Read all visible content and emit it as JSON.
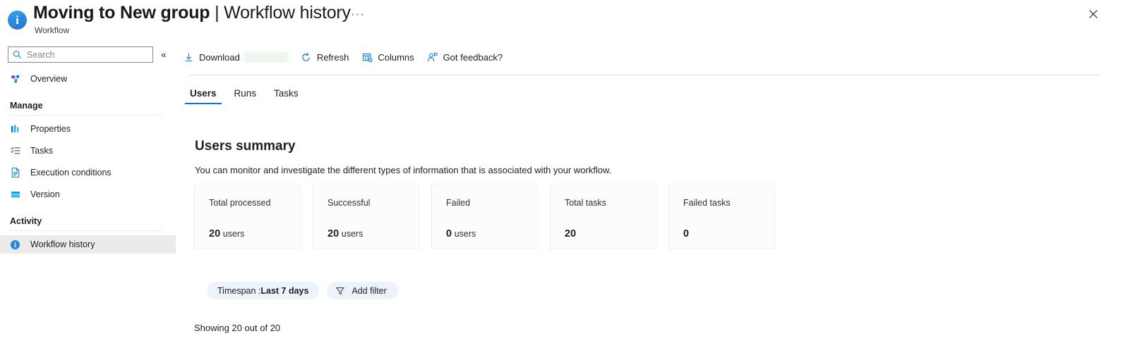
{
  "header": {
    "icon": "info-circle-icon",
    "title_main": "Moving to New group",
    "title_separator": "|",
    "title_secondary": "Workflow history",
    "subtitle": "Workflow",
    "overflow_label": "···",
    "close_label": "Close"
  },
  "sidebar": {
    "search": {
      "value": "",
      "placeholder": "Search",
      "icon": "search-icon"
    },
    "collapse": {
      "label": "«",
      "icon": "chevron-double-left-icon"
    },
    "overview": {
      "label": "Overview",
      "icon": "overview-icon"
    },
    "groups": [
      {
        "label": "Manage",
        "items": [
          {
            "label": "Properties",
            "icon": "properties-icon"
          },
          {
            "label": "Tasks",
            "icon": "tasks-list-icon"
          },
          {
            "label": "Execution conditions",
            "icon": "document-icon"
          },
          {
            "label": "Version",
            "icon": "version-icon"
          }
        ]
      },
      {
        "label": "Activity",
        "items": [
          {
            "label": "Workflow history",
            "icon": "info-circle-icon",
            "selected": true
          }
        ]
      }
    ]
  },
  "toolbar": {
    "items": [
      {
        "label": "Download",
        "icon": "download-icon",
        "redacted_after": true
      },
      {
        "label": "Refresh",
        "icon": "refresh-icon"
      },
      {
        "label": "Columns",
        "icon": "columns-icon"
      },
      {
        "label": "Got feedback?",
        "icon": "feedback-person-icon"
      }
    ]
  },
  "tabs": [
    {
      "label": "Users",
      "active": true
    },
    {
      "label": "Runs",
      "active": false
    },
    {
      "label": "Tasks",
      "active": false
    }
  ],
  "main": {
    "section_title": "Users summary",
    "section_description": "You can monitor and investigate the different types of information that is associated with your workflow.",
    "cards": [
      {
        "label": "Total processed",
        "value": "20",
        "unit": "users"
      },
      {
        "label": "Successful",
        "value": "20",
        "unit": "users"
      },
      {
        "label": "Failed",
        "value": "0",
        "unit": "users"
      },
      {
        "label": "Total tasks",
        "value": "20",
        "unit": ""
      },
      {
        "label": "Failed tasks",
        "value": "0",
        "unit": ""
      }
    ],
    "filters": [
      {
        "type": "applied",
        "prefix": "Timespan : ",
        "value": "Last 7 days"
      },
      {
        "type": "add",
        "label": "Add filter",
        "icon": "funnel-icon"
      }
    ],
    "showing": "Showing 20 out of 20"
  },
  "colors": {
    "accent": "#0078d4",
    "selected_nav_bg": "#edebe9",
    "pill_bg": "#edf3fb",
    "card_bg": "#fcfcfc",
    "divider": "#e1dfdd"
  }
}
